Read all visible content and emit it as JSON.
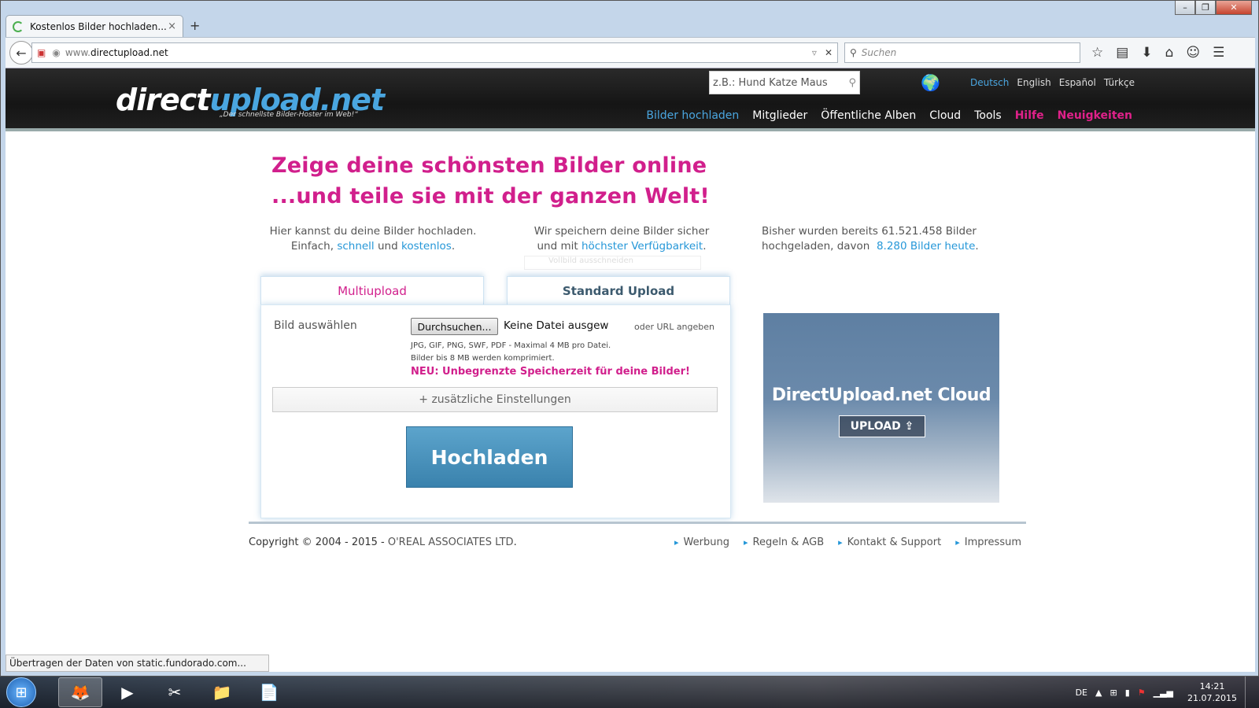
{
  "browser": {
    "tab_title": "Kostenlos Bilder hochladen...",
    "tab_close": "×",
    "new_tab": "+",
    "url_prefix": "www.",
    "url_domain": "directupload.net",
    "search_placeholder": "Suchen",
    "status": "Übertragen der Daten von static.fundorado.com..."
  },
  "site": {
    "logo_a": "direct",
    "logo_b": "upload.net",
    "tagline": "„Der schnellste Bilder-Hoster im Web!“",
    "search_placeholder": "z.B.: Hund Katze Maus",
    "languages": [
      "Deutsch",
      "English",
      "Español",
      "Türkçe"
    ],
    "nav": [
      "Bilder hochladen",
      "Mitglieder",
      "Öffentliche Alben",
      "Cloud",
      "Tools",
      "Hilfe",
      "Neuigkeiten"
    ],
    "headline_1": "Zeige deine schönsten Bilder online",
    "headline_2": "...und teile sie mit der ganzen Welt!",
    "col1": {
      "line1": "Hier kannst du deine Bilder hochladen.",
      "pre": "Einfach,",
      "link1": "schnell",
      "mid": "und",
      "link2": "kostenlos",
      "post": "."
    },
    "col2": {
      "line1": "Wir speichern deine Bilder sicher",
      "pre": "und mit",
      "link": "höchster Verfügbarkeit",
      "post": "."
    },
    "col3": {
      "line1_pre": "Bisher wurden bereits",
      "count": "61.521.458",
      "line1_post": "Bilder",
      "line2_pre": "hochgeladen, davon",
      "link": "8.280 Bilder heute",
      "post": "."
    },
    "ghost": "Vollbild ausschneiden",
    "upload_tabs": [
      "Multiupload",
      "Standard Upload"
    ],
    "field_label": "Bild auswählen",
    "browse_button": "Durchsuchen...",
    "no_file": "Keine Datei ausgew",
    "or_url": "oder URL angeben",
    "info_1": "JPG, GIF, PNG, SWF, PDF - Maximal 4 MB pro Datei.",
    "info_2": "Bilder bis 8 MB werden komprimiert.",
    "neu": "NEU: Unbegrenzte Speicherzeit für deine Bilder!",
    "settings": "+ zusätzliche Einstellungen",
    "upload_button": "Hochladen",
    "cloud_title": "DirectUpload.net Cloud",
    "cloud_button": "UPLOAD",
    "copyright": "Copyright © 2004 - 2015 -",
    "company": "O'REAL ASSOCIATES LTD",
    "footer_links": [
      "Werbung",
      "Regeln & AGB",
      "Kontakt & Support",
      "Impressum"
    ]
  },
  "taskbar": {
    "lang": "DE",
    "time": "14:21",
    "date": "21.07.2015"
  },
  "colors": {
    "accent": "#2597d8",
    "pink": "#d11f8c"
  }
}
